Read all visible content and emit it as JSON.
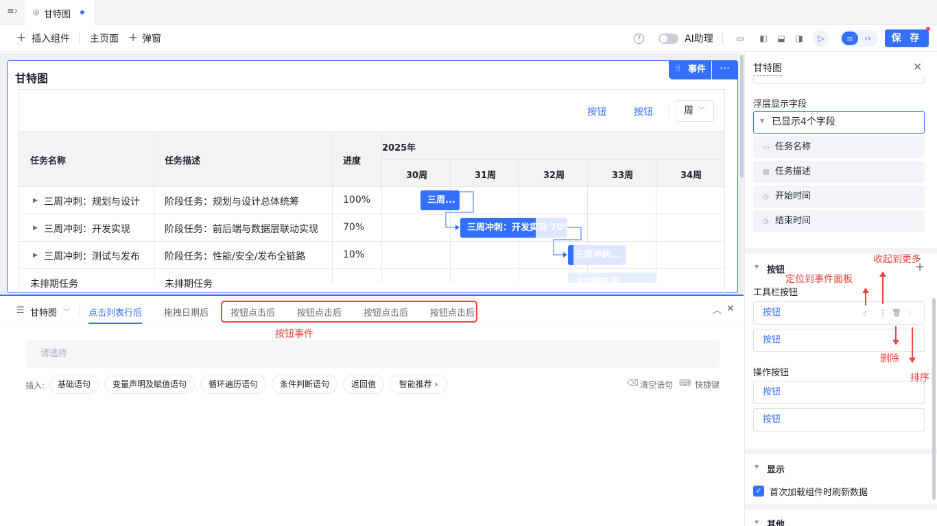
{
  "tabbar": {
    "tab_label": "甘特图"
  },
  "toolbar": {
    "insert_label": "插入组件",
    "home_label": "主页面",
    "popup_label": "弹窗",
    "ai_label": "AI助理",
    "save_label": "保 存"
  },
  "card": {
    "title": "甘特图",
    "event_label": "事件",
    "more_label": "···",
    "buttons": [
      "按钮",
      "按钮"
    ],
    "week_select": "周"
  },
  "gantt": {
    "columns": [
      "任务名称",
      "任务描述",
      "进度"
    ],
    "year": "2025年",
    "weeks": [
      "30周",
      "31周",
      "32周",
      "33周",
      "34周"
    ],
    "rows": [
      {
        "name": "三周冲刺：规划与设计",
        "desc": "阶段任务：规划与设计总体统筹",
        "progress": "100%",
        "bar": "三周..."
      },
      {
        "name": "三周冲刺：开发实现",
        "desc": "阶段任务：前后端与数据层联动实现",
        "progress": "70%",
        "bar": "三周冲刺：开发实现 70%"
      },
      {
        "name": "三周冲刺：测试与发布",
        "desc": "阶段任务：性能/安全/发布全链路",
        "progress": "10%",
        "bar": "三周冲刺..."
      },
      {
        "name": "未排期任务",
        "desc": "未排期任务",
        "progress": "",
        "bar": "未排期任务"
      }
    ]
  },
  "bottom": {
    "component": "甘特图",
    "tabs": [
      "点击列表行后",
      "拖拽日期后",
      "按钮点击后",
      "按钮点击后",
      "按钮点击后",
      "按钮点击后"
    ],
    "annotation": "按钮事件",
    "select_placeholder": "请选择",
    "insert_label": "插入:",
    "chips": [
      "基础语句",
      "变量声明及赋值语句",
      "循环遍历语句",
      "条件判断语句",
      "返回值",
      "智能推荐 ›"
    ],
    "clear_label": "清空语句",
    "shortcut_label": "快捷键"
  },
  "panel": {
    "title": "甘特图",
    "overlay_label": "浮层显示字段",
    "overlay_value": "已显示4个字段",
    "fields": [
      "任务名称",
      "任务描述",
      "开始时间",
      "结束时间"
    ],
    "button_section": "按钮",
    "toolbar_buttons_label": "工具栏按钮",
    "toolbar_buttons": [
      "按钮",
      "按钮"
    ],
    "action_buttons_label": "操作按钮",
    "action_buttons": [
      "按钮",
      "按钮"
    ],
    "display_section": "显示",
    "refresh_label": "首次加载组件时刷新数据",
    "other_section": "其他"
  },
  "annotations": {
    "locate": "定位到事件面板",
    "collapse": "收起到更多",
    "delete": "删除",
    "sort": "排序"
  },
  "colors": {
    "accent": "#3370ff",
    "annotation": "#e8453c"
  }
}
